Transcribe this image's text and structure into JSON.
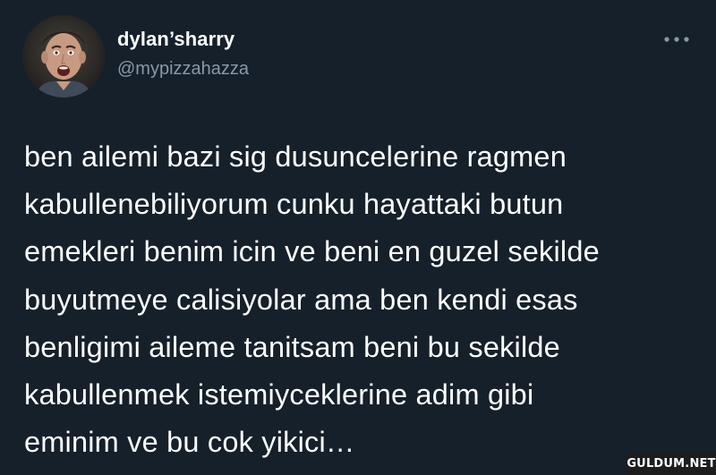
{
  "tweet": {
    "author": {
      "display_name": "dylan’sharry",
      "handle": "@mypizzahazza",
      "avatar_icon": "profile-photo-avatar"
    },
    "more_icon": "more-horizontal-icon",
    "text": "ben ailemi bazi sig dusuncelerine ragmen\nkabullenebiliyorum cunku hayattaki butun\nemekleri benim icin ve beni en guzel sekilde\nbuyutmeye calisiyolar ama ben kendi esas\nbenligimi aileme tanitsam beni bu sekilde\nkabullenmek istemiyceklerine adim gibi\neminim ve bu cok yikici…"
  },
  "watermark": {
    "text": "GULDUM.NET"
  },
  "colors": {
    "background": "#15202b",
    "primary_text": "#ffffff",
    "secondary_text": "#8b98a5"
  }
}
